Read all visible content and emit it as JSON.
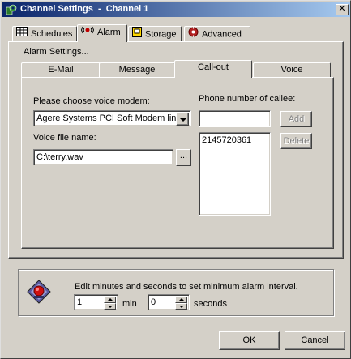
{
  "window": {
    "title": "Channel Settings  -  Channel 1",
    "close_glyph": "✕"
  },
  "top_tabs": [
    {
      "label": "Schedules",
      "icon": "schedule-icon"
    },
    {
      "label": "Alarm",
      "icon": "alarm-icon"
    },
    {
      "label": "Storage",
      "icon": "storage-icon"
    },
    {
      "label": "Advanced",
      "icon": "advanced-icon"
    }
  ],
  "alarm_settings_label": "Alarm Settings...",
  "sub_tabs": [
    {
      "label": "E-Mail"
    },
    {
      "label": "Message"
    },
    {
      "label": "Call-out"
    },
    {
      "label": "Voice"
    }
  ],
  "callout": {
    "modem_label": "Please choose voice modem:",
    "modem_value": "Agere Systems PCI Soft Modem line (",
    "voice_file_label": "Voice file name:",
    "voice_file_value": "C:\\terry.wav",
    "browse_label": "...",
    "phone_label": "Phone number of callee:",
    "phone_input_value": "",
    "add_label": "Add",
    "delete_label": "Delete",
    "phone_list": [
      "2145720361"
    ]
  },
  "interval": {
    "text": "Edit minutes and seconds to set minimum alarm interval.",
    "minutes_value": "1",
    "minutes_unit": "min",
    "seconds_value": "0",
    "seconds_unit": "seconds"
  },
  "footer": {
    "ok_label": "OK",
    "cancel_label": "Cancel"
  },
  "colors": {
    "face": "#d4d0c8",
    "title_start": "#0a246a",
    "title_end": "#a6caf0"
  }
}
